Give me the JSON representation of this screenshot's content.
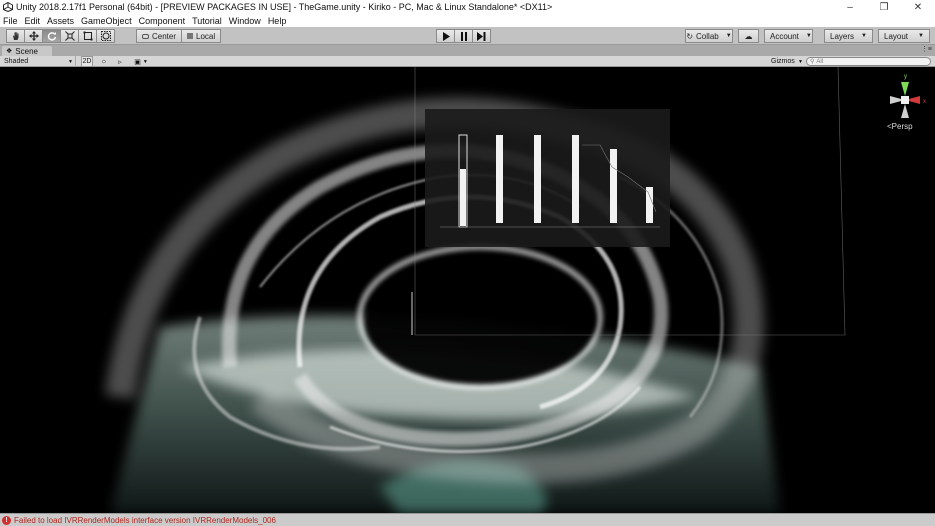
{
  "window": {
    "title": "Unity 2018.2.17f1 Personal (64bit) - [PREVIEW PACKAGES IN USE] - TheGame.unity - Kiriko - PC, Mac & Linux Standalone* <DX11>",
    "controls": [
      "minimize-icon",
      "restore-icon",
      "close-icon"
    ]
  },
  "menu": [
    "File",
    "Edit",
    "Assets",
    "GameObject",
    "Component",
    "Tutorial",
    "Window",
    "Help"
  ],
  "toolbar": {
    "tools": [
      "hand-icon",
      "move-icon",
      "rotate-icon",
      "scale-icon",
      "rect-icon",
      "transform-icon"
    ],
    "active_tool": "rotate-icon",
    "pivot_label": "Center",
    "space_label": "Local",
    "play_controls": [
      "play-icon",
      "pause-icon",
      "step-icon"
    ],
    "collab_label": "Collab",
    "account_label": "Account",
    "layers_label": "Layers",
    "layout_label": "Layout"
  },
  "scene": {
    "tab_label": "Scene",
    "shading_mode": "Shaded",
    "mode_2d": "2D",
    "gizmos_label": "Gizmos",
    "search_placeholder": "All",
    "persp_label": "Persp",
    "colors": {
      "smoke": "#e8e8e8",
      "teal_glow": "#7ecfc0",
      "background": "#000000"
    }
  },
  "status": {
    "message": "Failed to load IVRRenderModels interface version IVRRenderModels_006",
    "color": "#b3261e"
  }
}
